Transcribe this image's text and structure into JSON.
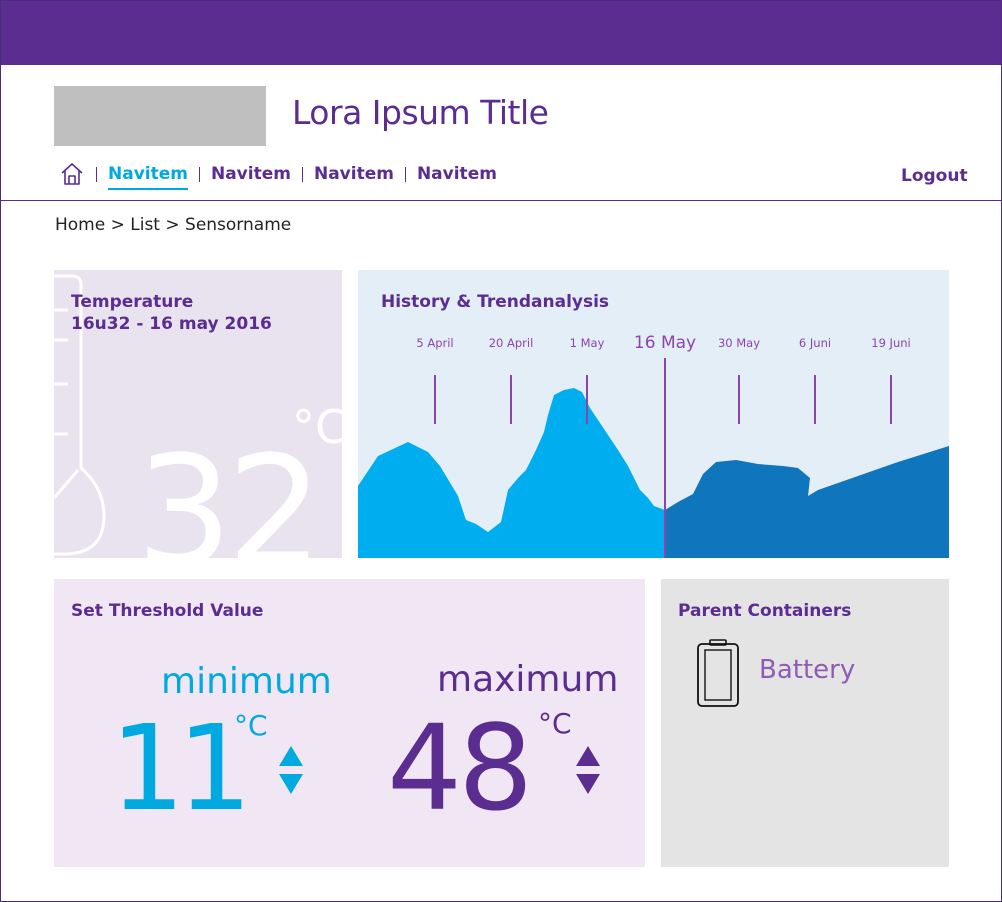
{
  "colors": {
    "brand_purple": "#5b2d90",
    "accent_cyan": "#00a9e0",
    "trend_past": "#00aeef",
    "trend_future": "#0f75bc",
    "temp_bg": "#e8e3ee",
    "history_bg": "#e3eef7",
    "threshold_bg": "#f1e6f3",
    "parent_bg": "#e4e4e4"
  },
  "header": {
    "title": "Lora Ipsum Title",
    "logo_icon": "logo-placeholder",
    "home_icon": "home-icon",
    "nav": [
      {
        "label": "Navitem",
        "active": true
      },
      {
        "label": "Navitem",
        "active": false
      },
      {
        "label": "Navitem",
        "active": false
      },
      {
        "label": "Navitem",
        "active": false
      }
    ],
    "logout_label": "Logout"
  },
  "breadcrumb": {
    "text": "Home > List > Sensorname"
  },
  "temperature": {
    "title": "Temperature",
    "timestamp": "16u32 - 16 may 2016",
    "value": "32",
    "unit": "°C",
    "icon": "thermometer-icon"
  },
  "history": {
    "title": "History & Trendanalysis",
    "dates": [
      {
        "label": "5 April",
        "current": false
      },
      {
        "label": "20 April",
        "current": false
      },
      {
        "label": "1 May",
        "current": false
      },
      {
        "label": "16 May",
        "current": true
      },
      {
        "label": "30 May",
        "current": false
      },
      {
        "label": "6 Juni",
        "current": false
      },
      {
        "label": "19 Juni",
        "current": false
      }
    ]
  },
  "threshold": {
    "title": "Set Threshold Value",
    "minimum": {
      "label": "minimum",
      "value": "11",
      "unit": "°C"
    },
    "maximum": {
      "label": "maximum",
      "value": "48",
      "unit": "°C"
    }
  },
  "parent": {
    "title": "Parent Containers",
    "items": [
      {
        "label": "Battery",
        "icon": "battery-icon"
      }
    ]
  }
}
